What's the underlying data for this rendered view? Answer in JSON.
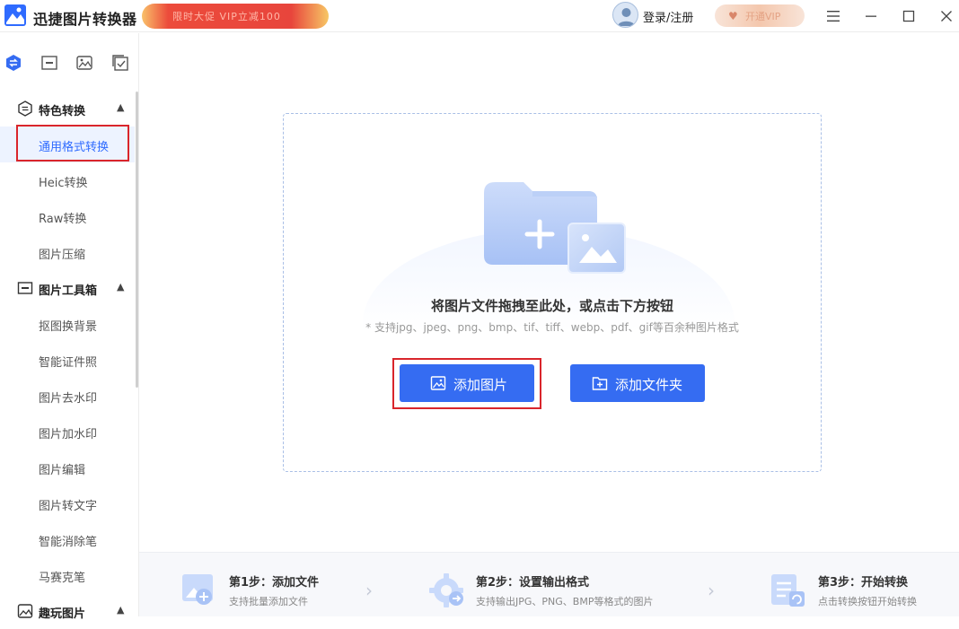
{
  "app": {
    "title": "迅捷图片转换器"
  },
  "titlebar": {
    "promo_text": "限时大促 VIP立减100",
    "login_label": "登录/注册",
    "vip_label": "开通VIP"
  },
  "sidebar": {
    "tabs": [
      {
        "icon": "convert-icon"
      },
      {
        "icon": "toolbox-icon"
      },
      {
        "icon": "image-icon"
      },
      {
        "icon": "checkbox-icon"
      }
    ],
    "categories": [
      {
        "label": "特色转换",
        "items": [
          "通用格式转换",
          "Heic转换",
          "Raw转换",
          "图片压缩"
        ]
      },
      {
        "label": "图片工具箱",
        "items": [
          "抠图换背景",
          "智能证件照",
          "图片去水印",
          "图片加水印",
          "图片编辑",
          "图片转文字",
          "智能消除笔",
          "马赛克笔"
        ]
      },
      {
        "label": "趣玩图片",
        "items": []
      }
    ],
    "active_item": "通用格式转换"
  },
  "main": {
    "drop_title": "将图片文件拖拽至此处，或点击下方按钮",
    "drop_sub": "* 支持jpg、jpeg、png、bmp、tif、tiff、webp、pdf、gif等百余种图片格式",
    "add_image_label": "添加图片",
    "add_folder_label": "添加文件夹"
  },
  "steps": [
    {
      "title": "第1步：添加文件",
      "desc": "支持批量添加文件"
    },
    {
      "title": "第2步：设置输出格式",
      "desc": "支持输出JPG、PNG、BMP等格式的图片"
    },
    {
      "title": "第3步：开始转换",
      "desc": "点击转换按钮开始转换"
    }
  ],
  "colors": {
    "accent": "#356cf2",
    "highlight": "#d9252b"
  }
}
